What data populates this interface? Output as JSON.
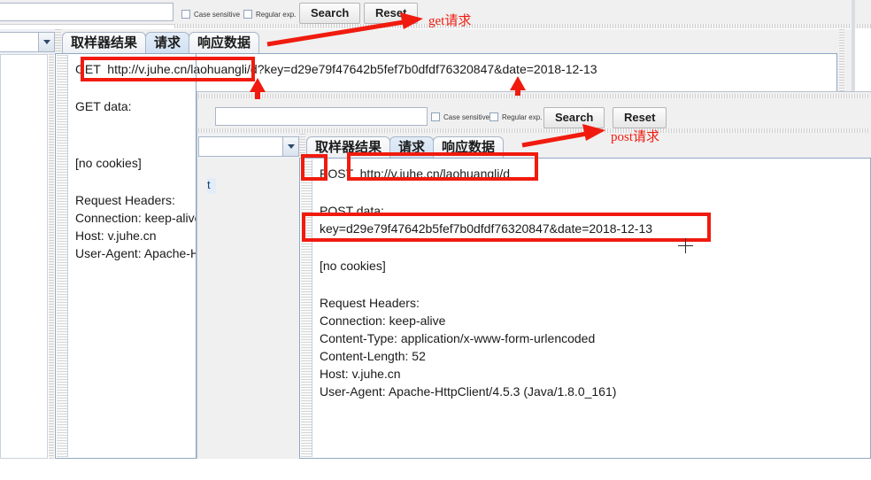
{
  "window_get": {
    "name": "get-request-window",
    "search_toolbar": {
      "search_value": "",
      "search_placeholder": "",
      "case_sensitive_label": "Case sensitive",
      "regular_exp_label": "Regular exp.",
      "search_button": "Search",
      "reset_button": "Reset"
    },
    "tabs": [
      {
        "label": "取样器结果",
        "active": false
      },
      {
        "label": "请求",
        "active": true
      },
      {
        "label": "响应数据",
        "active": false
      }
    ],
    "request": {
      "method": "GET",
      "url": "http://v.juhe.cn/laohuangli/d",
      "query": "?key=d29e79f47642b5fef7b0dfdf76320847&date=2018-12-13",
      "full_line": "GET  http://v.juhe.cn/laohuangli/d?key=d29e79f47642b5fef7b0dfdf76320847&date=2018-12-13",
      "data_label": "GET data:",
      "data_value": "",
      "cookies": "[no cookies]",
      "headers_label": "Request Headers:",
      "headers": [
        "Connection: keep-alive",
        "Host: v.juhe.cn",
        "User-Agent: Apache-Http"
      ]
    }
  },
  "window_post": {
    "name": "post-request-window",
    "search_toolbar": {
      "search_value": "",
      "search_placeholder": "",
      "case_sensitive_label": "Case sensitive",
      "regular_exp_label": "Regular exp.",
      "search_button": "Search",
      "reset_button": "Reset"
    },
    "tabs": [
      {
        "label": "取样器结果",
        "active": false
      },
      {
        "label": "请求",
        "active": true
      },
      {
        "label": "响应数据",
        "active": false
      }
    ],
    "request": {
      "method": "POST",
      "url": "http://v.juhe.cn/laohuangli/d",
      "full_line": "POST  http://v.juhe.cn/laohuangli/d",
      "data_label": "POST data:",
      "data_value": "key=d29e79f47642b5fef7b0dfdf76320847&date=2018-12-13",
      "cookies": "[no cookies]",
      "headers_label": "Request Headers:",
      "headers": [
        "Connection: keep-alive",
        "Content-Type: application/x-www-form-urlencoded",
        "Content-Length: 52",
        "Host: v.juhe.cn",
        "User-Agent: Apache-HttpClient/4.5.3 (Java/1.8.0_161)"
      ]
    }
  },
  "annotations": {
    "accent_color": "#f01b0e",
    "get_label": "get请求",
    "post_label": "post请求"
  }
}
